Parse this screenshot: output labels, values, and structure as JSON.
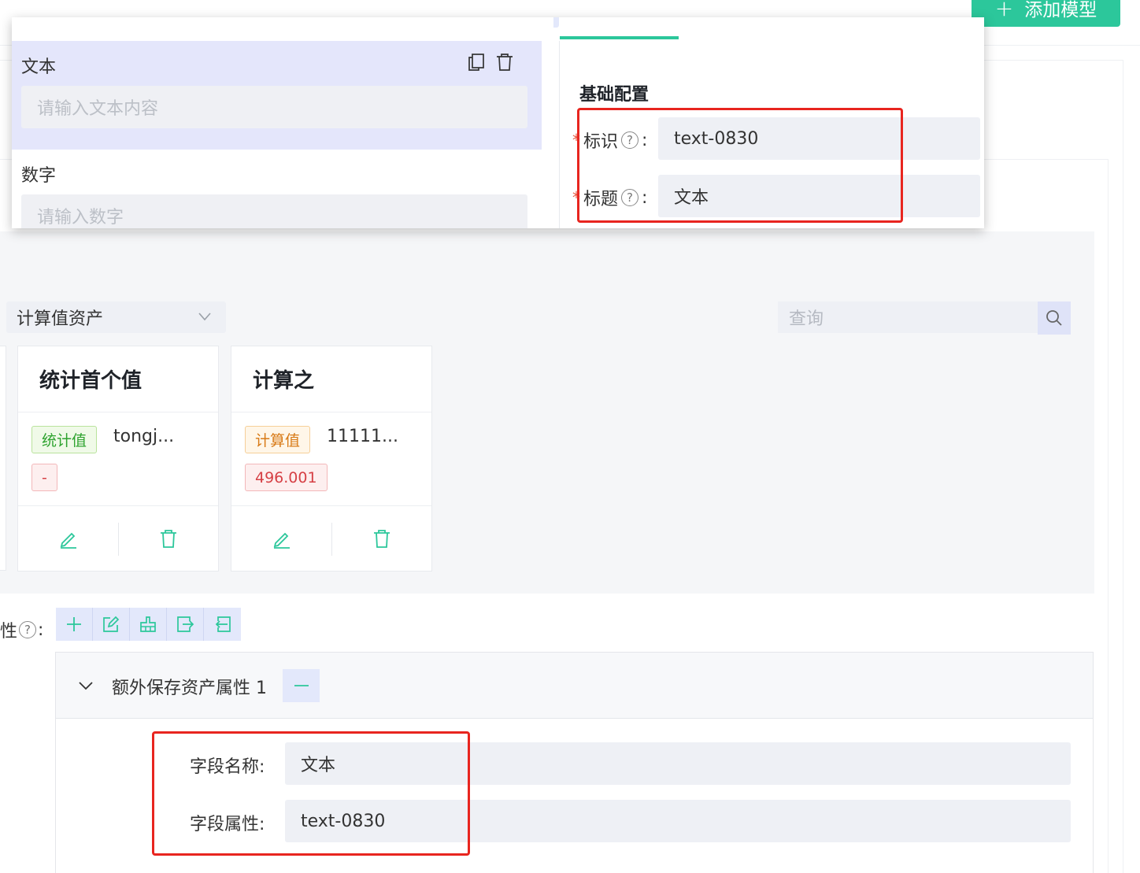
{
  "header": {
    "add_model_label": "添加模型",
    "add_model_icon": "plus-icon"
  },
  "popup": {
    "left_items": [
      {
        "label": "文本",
        "placeholder": "请输入文本内容",
        "selected": true
      },
      {
        "label": "数字",
        "placeholder": "请输入数字",
        "selected": false
      }
    ],
    "right": {
      "section_title": "基础配置",
      "fields": [
        {
          "label": "标识",
          "value": "text-0830",
          "required": true
        },
        {
          "label": "标题",
          "value": "文本",
          "required": true
        }
      ]
    }
  },
  "filter": {
    "select_value": "计算值资产",
    "search_placeholder": "查询"
  },
  "cards": [
    {
      "title": "统计首个值",
      "tag": "统计值",
      "tag_color": "green",
      "value": "tongj...",
      "tag2": "-"
    },
    {
      "title": "计算之",
      "tag": "计算值",
      "tag_color": "orange",
      "value": "11111...",
      "tag2": "496.001"
    }
  ],
  "attributes": {
    "label_fragment": "性",
    "colon": ":",
    "toolbar_icons": [
      "plus-icon",
      "edit-icon",
      "clean-icon",
      "export-icon",
      "import-icon"
    ],
    "group_title": "额外保存资产属性 1",
    "fields": [
      {
        "label": "字段名称",
        "value": "文本"
      },
      {
        "label": "字段属性",
        "value": "text-0830"
      }
    ]
  },
  "colors": {
    "accent": "#2cc79b",
    "highlight_box": "#e8251f",
    "selected_bg": "#e4e6fb"
  }
}
